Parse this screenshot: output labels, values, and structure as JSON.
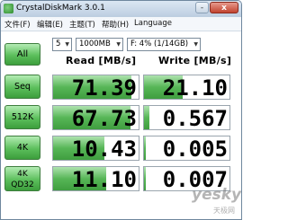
{
  "window": {
    "title": "CrystalDiskMark 3.0.1",
    "min_label": "-",
    "close_label": "x"
  },
  "menu": [
    "文件(F)",
    "编辑(E)",
    "主题(T)",
    "帮助(H)",
    "Language"
  ],
  "controls": {
    "all_label": "All",
    "runs": "5",
    "size": "1000MB",
    "drive": "F: 4% (1/14GB)"
  },
  "headers": {
    "read": "Read [MB/s]",
    "write": "Write [MB/s]"
  },
  "rows": [
    {
      "label": "Seq",
      "read": "71.39",
      "write": "21.10",
      "read_fill_pct": 92,
      "write_fill_pct": 45
    },
    {
      "label": "512K",
      "read": "67.73",
      "write": "0.567",
      "read_fill_pct": 90,
      "write_fill_pct": 6
    },
    {
      "label": "4K",
      "read": "10.43",
      "write": "0.005",
      "read_fill_pct": 60,
      "write_fill_pct": 2
    },
    {
      "label": "4K QD32",
      "read": "11.10",
      "write": "0.007",
      "read_fill_pct": 62,
      "write_fill_pct": 2
    }
  ],
  "watermark": {
    "text": "yesky",
    "sub": "天极网"
  },
  "colors": {
    "accent_green": "#57b657",
    "frame": "#cfdae6"
  }
}
